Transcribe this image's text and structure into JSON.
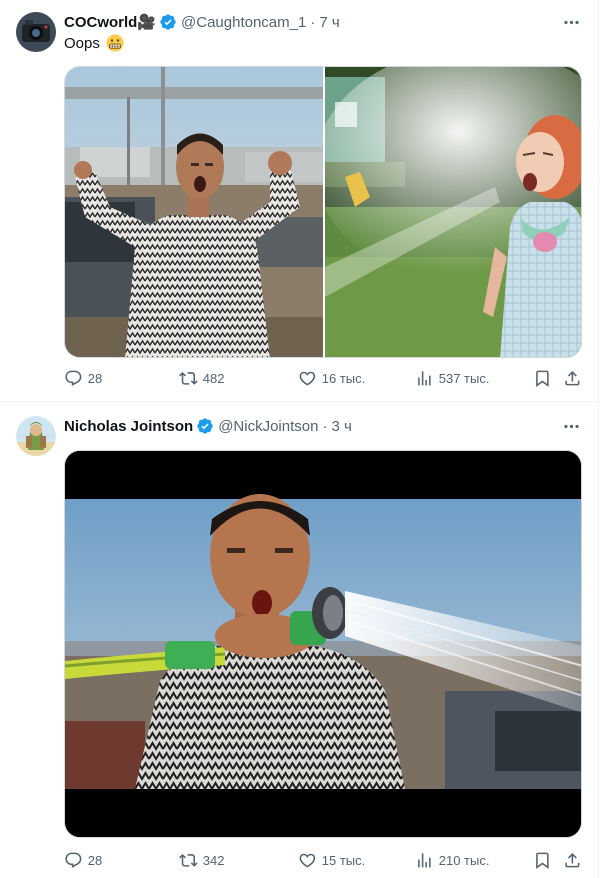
{
  "tweets": [
    {
      "author_name": "COCworld",
      "author_name_suffix": "🎥",
      "handle": "@Caughtoncam_1",
      "separator": "·",
      "time": "7 ч",
      "text": "Oops",
      "emoji": "grimacing-face",
      "media": [
        "man-in-patterned-shirt-shouting",
        "girl-sprayed-by-water-hose"
      ],
      "stats": {
        "replies": "28",
        "retweets": "482",
        "likes": "16 тыс.",
        "views": "537 тыс."
      }
    },
    {
      "author_name": "Nicholas Jointson",
      "handle": "@NickJointson",
      "separator": "·",
      "time": "3 ч",
      "media": [
        "man-spraying-garden-hose"
      ],
      "stats": {
        "replies": "28",
        "retweets": "342",
        "likes": "15 тыс.",
        "views": "210 тыс."
      }
    }
  ],
  "colors": {
    "accent": "#1d9bf0",
    "secondary_text": "#536471",
    "primary_text": "#0f1419",
    "border": "#eff3f4"
  },
  "icons": [
    "more-icon",
    "verified-badge-icon",
    "reply-icon",
    "retweet-icon",
    "like-icon",
    "views-icon",
    "bookmark-icon",
    "share-icon"
  ]
}
